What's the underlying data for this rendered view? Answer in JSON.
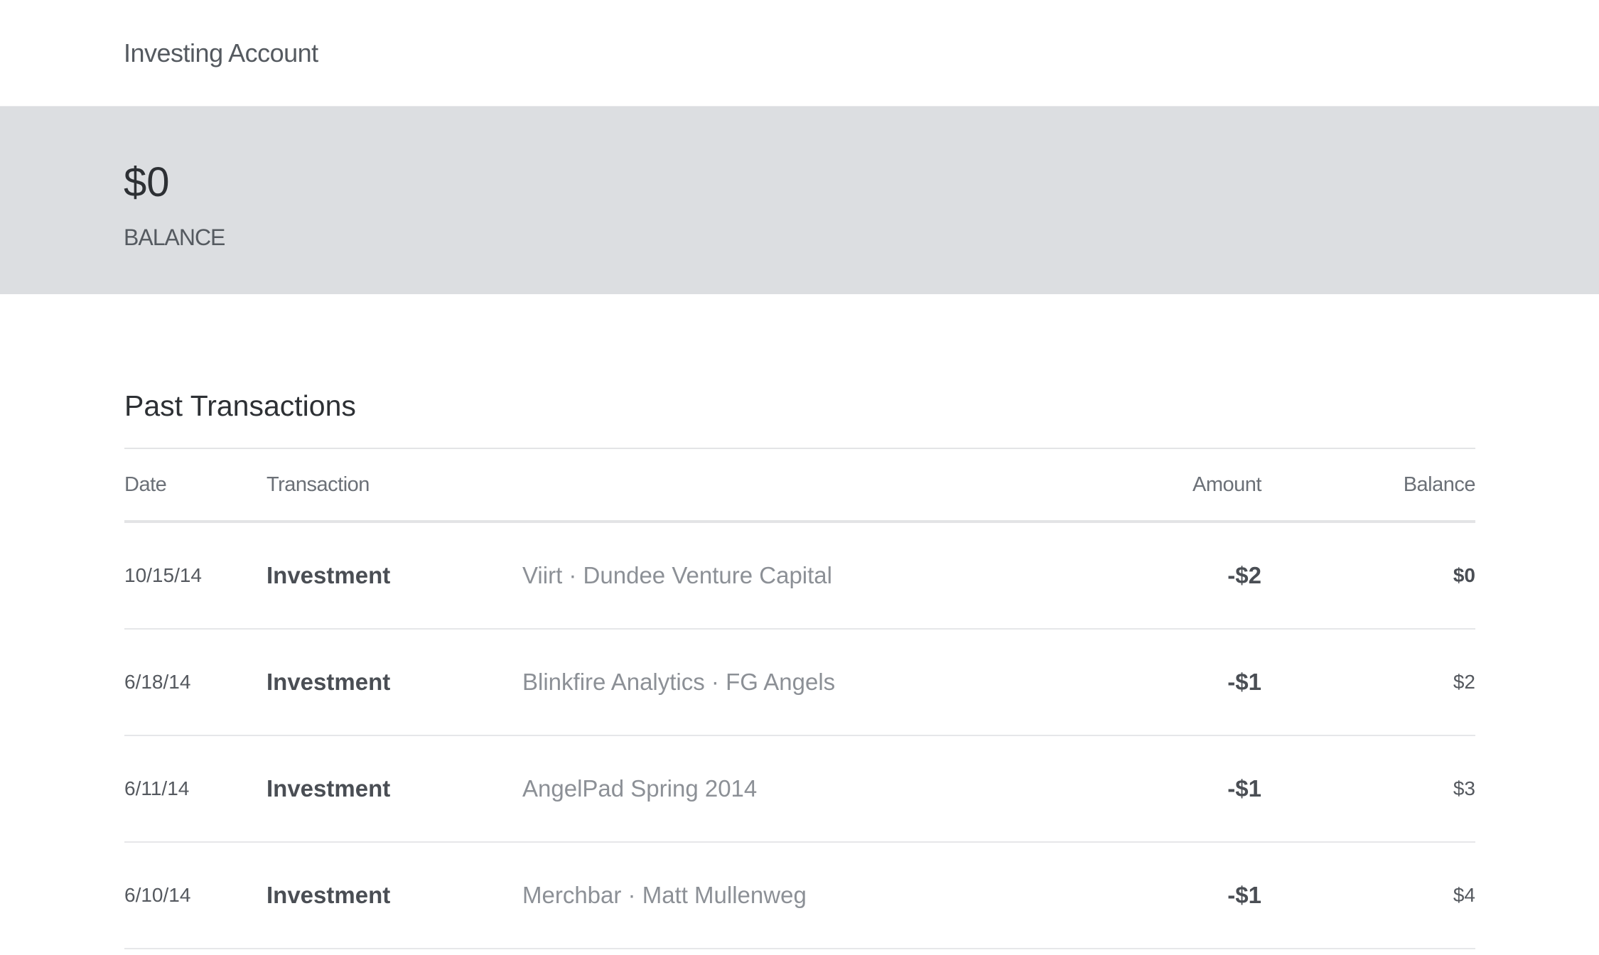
{
  "header": {
    "title": "Investing Account"
  },
  "summary": {
    "balance": "$0",
    "balance_label": "BALANCE"
  },
  "transactions": {
    "title": "Past Transactions",
    "columns": {
      "date": "Date",
      "transaction": "Transaction",
      "amount": "Amount",
      "balance": "Balance"
    },
    "rows": [
      {
        "date": "10/15/14",
        "type": "Investment",
        "description": "Viirt · Dundee Venture Capital",
        "amount": "-$2",
        "balance": "$0"
      },
      {
        "date": "6/18/14",
        "type": "Investment",
        "description": "Blinkfire Analytics · FG Angels",
        "amount": "-$1",
        "balance": "$2"
      },
      {
        "date": "6/11/14",
        "type": "Investment",
        "description": "AngelPad Spring 2014",
        "amount": "-$1",
        "balance": "$3"
      },
      {
        "date": "6/10/14",
        "type": "Investment",
        "description": "Merchbar · Matt Mullenweg",
        "amount": "-$1",
        "balance": "$4"
      }
    ]
  }
}
